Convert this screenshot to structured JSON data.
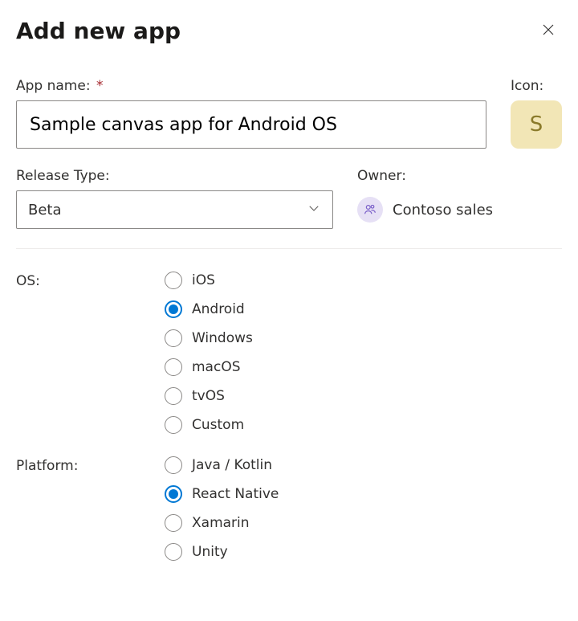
{
  "dialog": {
    "title": "Add new app"
  },
  "appName": {
    "label": "App name:",
    "required": "*",
    "value": "Sample canvas app for Android OS"
  },
  "icon": {
    "label": "Icon:",
    "letter": "S"
  },
  "releaseType": {
    "label": "Release Type:",
    "value": "Beta"
  },
  "owner": {
    "label": "Owner:",
    "name": "Contoso sales"
  },
  "os": {
    "label": "OS:",
    "options": [
      "iOS",
      "Android",
      "Windows",
      "macOS",
      "tvOS",
      "Custom"
    ],
    "selected": "Android"
  },
  "platform": {
    "label": "Platform:",
    "options": [
      "Java / Kotlin",
      "React Native",
      "Xamarin",
      "Unity"
    ],
    "selected": "React Native"
  }
}
